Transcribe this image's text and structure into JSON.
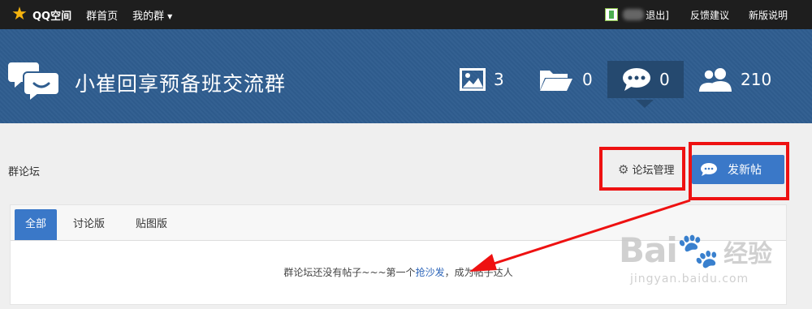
{
  "topbar": {
    "logo_text": "QQ空间",
    "nav": [
      {
        "label": "群首页"
      },
      {
        "label": "我的群"
      }
    ],
    "logout": "退出]",
    "feedback": "反馈建议",
    "new_version": "新版说明"
  },
  "banner": {
    "group_name": "小崔回享预备班交流群",
    "stats": {
      "photos": "3",
      "files": "0",
      "messages": "0",
      "members": "210"
    }
  },
  "forum": {
    "title": "群论坛",
    "manage_label": "论坛管理",
    "new_post_label": "发新帖",
    "tabs": [
      {
        "label": "全部",
        "active": true
      },
      {
        "label": "讨论版",
        "active": false
      },
      {
        "label": "贴图版",
        "active": false
      }
    ],
    "empty_prefix": "群论坛还没有帖子~~~第一个",
    "empty_link": "抢沙发",
    "empty_suffix": "，成为帖子达人"
  },
  "watermark": {
    "brand": "Bai",
    "brand_cn": "经验",
    "url": "jingyan.baidu.com"
  },
  "colors": {
    "banner": "#2f5d8f",
    "accent": "#3a78c8",
    "highlight": "#ee1111"
  }
}
